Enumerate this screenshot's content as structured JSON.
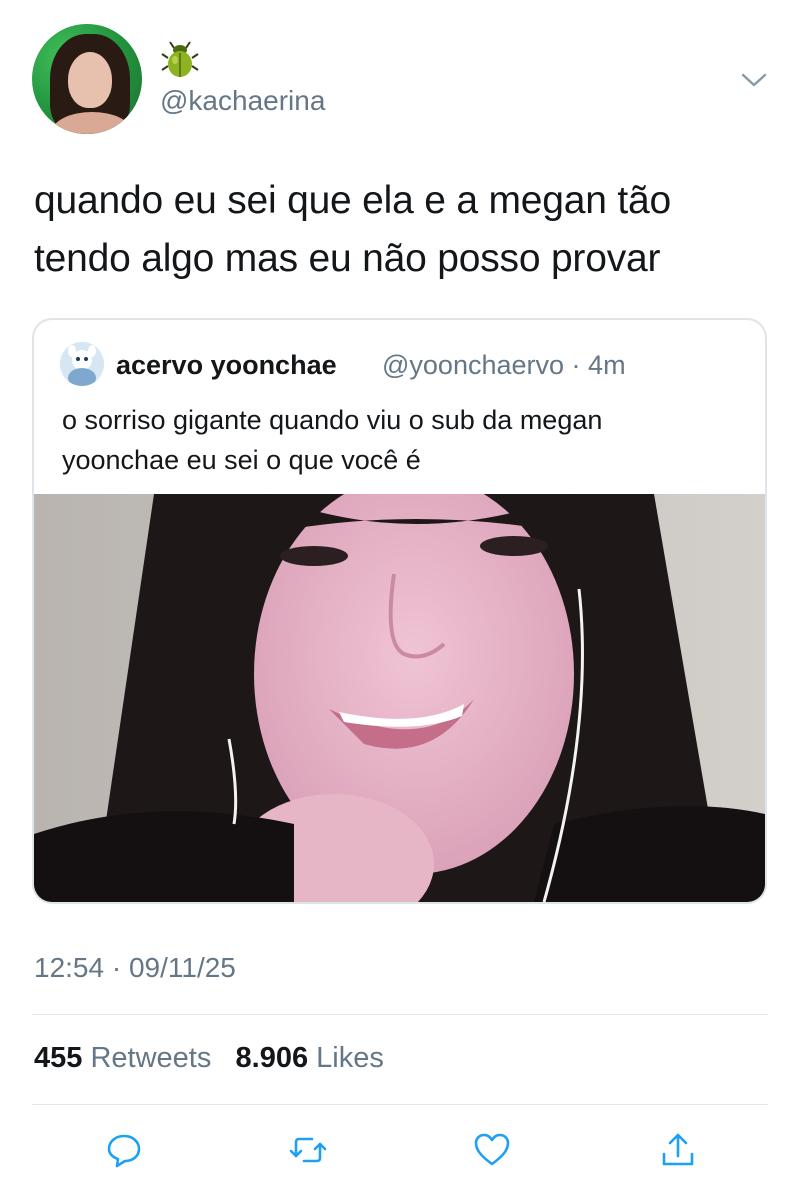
{
  "tweet": {
    "handle": "@kachaerina",
    "name_emoji": "beetle-icon",
    "text_line1": "quando eu sei que ela e a megan tão",
    "text_line2": "tendo algo mas eu não posso provar",
    "time": "12:54",
    "date": "09/11/25",
    "separator": "·"
  },
  "quoted": {
    "name": "acervo yoonchae",
    "handle": "@yoonchaervo",
    "separator": "·",
    "age": "4m",
    "text_line1": "o sorriso gigante quando viu o sub da megan",
    "text_line2": "yoonchae eu sei o que você é"
  },
  "stats": {
    "retweets_count": "455",
    "retweets_label": "Retweets",
    "likes_count": "8.906",
    "likes_label": "Likes"
  },
  "actions": [
    "reply-icon",
    "retweet-icon",
    "like-icon",
    "share-icon"
  ],
  "colors": {
    "text": "#14171a",
    "secondary": "#657786",
    "border": "#dfe4e8",
    "icon": "#1da1f2"
  }
}
